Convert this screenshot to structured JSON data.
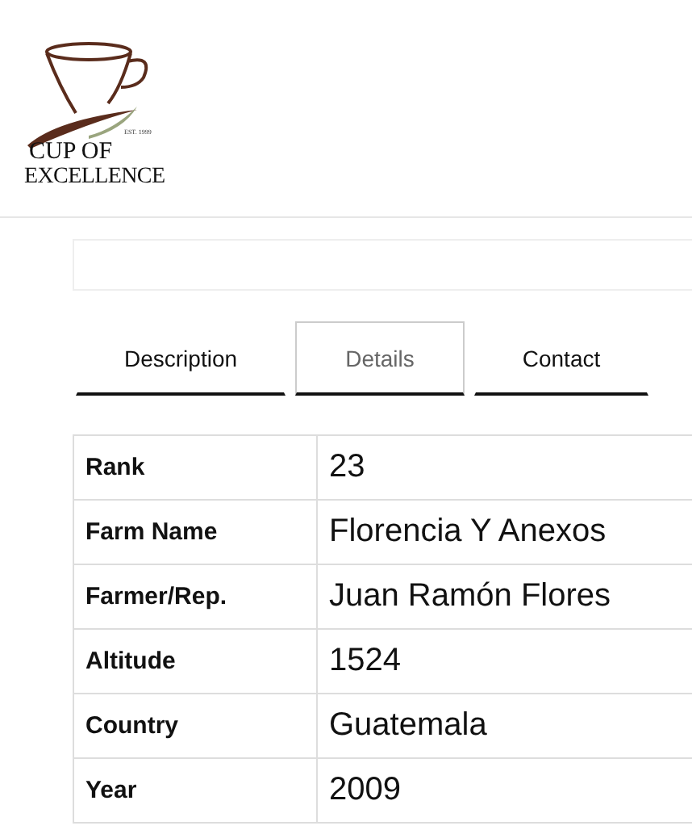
{
  "logo": {
    "est": "EST. 1999",
    "line1": "CUP OF",
    "line2": "EXCELLENCE"
  },
  "tabs": [
    {
      "label": "Description",
      "selected": false
    },
    {
      "label": "Details",
      "selected": true
    },
    {
      "label": "Contact",
      "selected": false
    }
  ],
  "details": [
    {
      "label": "Rank",
      "value": "23"
    },
    {
      "label": "Farm Name",
      "value": "Florencia Y Anexos"
    },
    {
      "label": "Farmer/Rep.",
      "value": "Juan Ramón Flores"
    },
    {
      "label": "Altitude",
      "value": "1524"
    },
    {
      "label": "Country",
      "value": "Guatemala"
    },
    {
      "label": "Year",
      "value": "2009"
    }
  ]
}
